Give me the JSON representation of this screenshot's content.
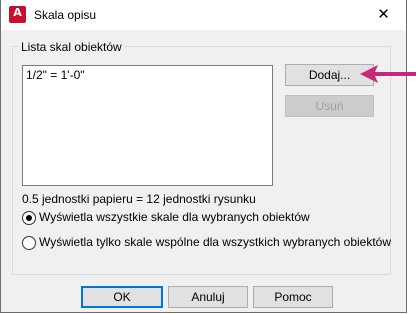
{
  "window": {
    "title": "Skala opisu",
    "app_icon_letter": "A",
    "close_symbol": "✕"
  },
  "group": {
    "legend": "Lista skal obiektów",
    "list_items": [
      "1/2\" = 1'-0\""
    ]
  },
  "buttons": {
    "add": "Dodaj...",
    "remove": "Usuń",
    "ok": "OK",
    "cancel": "Anuluj",
    "help": "Pomoc"
  },
  "ratio_text": "0.5 jednostki papieru = 12 jednostki rysunku",
  "radios": {
    "option1": "Wyświetla wszystkie skale dla wybranych obiektów",
    "option2": "Wyświetla tylko skale wspólne dla wszystkich wybranych obiektów",
    "selected": "option1"
  },
  "colors": {
    "annotation_arrow": "#c8287a",
    "app_icon": "#c8102e",
    "focus_border": "#0078d7"
  }
}
